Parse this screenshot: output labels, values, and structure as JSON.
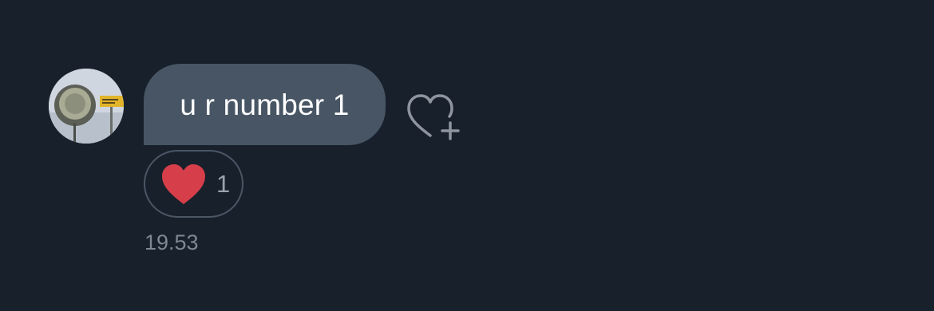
{
  "message": {
    "text": "u r number 1",
    "timestamp": "19.53"
  },
  "reaction": {
    "icon": "red-heart-icon",
    "count": "1"
  },
  "add_reaction": {
    "icon": "heart-plus-icon"
  },
  "colors": {
    "background": "#18202b",
    "bubble": "#475564",
    "heart": "#d63f4a"
  }
}
